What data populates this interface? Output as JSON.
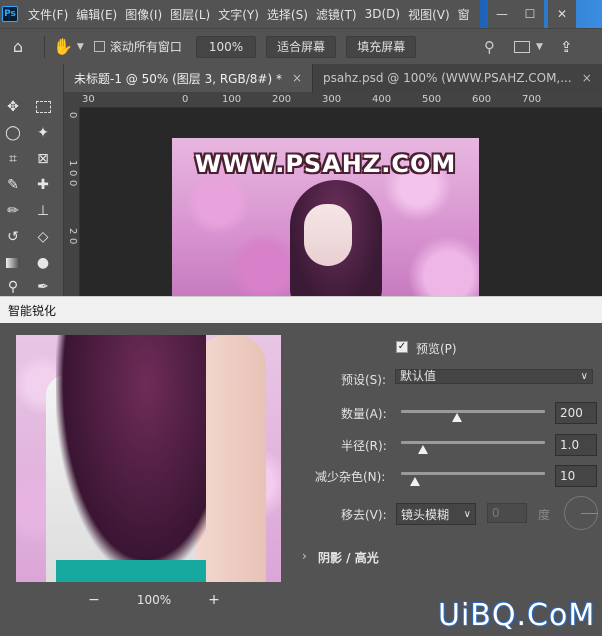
{
  "app": {
    "logo": "Ps",
    "menu": [
      "文件(F)",
      "编辑(E)",
      "图像(I)",
      "图层(L)",
      "文字(Y)",
      "选择(S)",
      "滤镜(T)",
      "3D(D)",
      "视图(V)",
      "窗"
    ],
    "window_controls": [
      "—",
      "☐",
      "✕"
    ]
  },
  "options_bar": {
    "scroll_all_label": "滚动所有窗口",
    "zoom_value": "100%",
    "fit_screen": "适合屏幕",
    "fill_screen": "填充屏幕"
  },
  "tabs": [
    {
      "label": "未标题-1 @ 50% (图层 3, RGB/8#) *",
      "close": "×"
    },
    {
      "label": "psahz.psd @ 100% (WWW.PSAHZ.COM,...",
      "close": "×"
    }
  ],
  "ruler": {
    "h_ticks": [
      "30",
      "0",
      "100",
      "200",
      "300",
      "400",
      "500",
      "600",
      "700"
    ],
    "v_ticks": [
      "0",
      "1",
      "0",
      "0",
      "2",
      "0"
    ]
  },
  "document": {
    "title_text": "WWW.PSAHZ.COM"
  },
  "dialog": {
    "title": "智能锐化",
    "preview_label": "预览(P)",
    "preset_label": "预设(S):",
    "preset_value": "默认值",
    "amount_label": "数量(A):",
    "amount_value": "200",
    "amount_fraction": 0.39,
    "radius_label": "半径(R):",
    "radius_value": "1.0",
    "radius_fraction": 0.15,
    "noise_label": "减少杂色(N):",
    "noise_value": "10",
    "noise_fraction": 0.1,
    "remove_label": "移去(V):",
    "remove_value": "镜头模糊",
    "angle_value": "0",
    "angle_unit": "度",
    "shadow_section": "阴影 / 高光",
    "zoom_value": "100%",
    "zoom_out_icon": "−",
    "zoom_in_icon": "+"
  },
  "watermark": "UiBQ.CoM"
}
